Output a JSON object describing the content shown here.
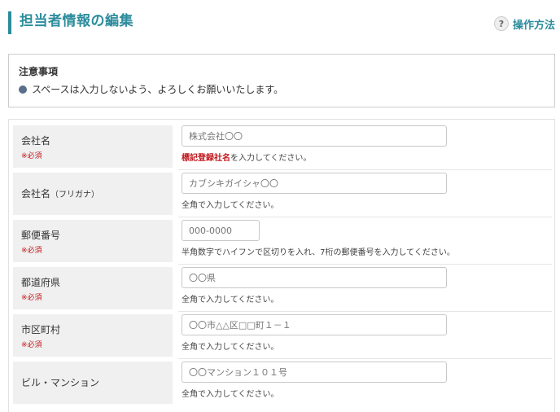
{
  "header": {
    "title": "担当者情報の編集",
    "help_icon": "question-circle-icon",
    "help_label": "操作方法"
  },
  "notice": {
    "title": "注意事項",
    "items": [
      "スペースは入力しないよう、よろしくお願いいたします。"
    ]
  },
  "form": {
    "company": {
      "label": "会社名",
      "required": "※必須",
      "placeholder": "株式会社〇〇",
      "help_emph": "標記登録社名",
      "help_rest": "を入力してください。"
    },
    "company_kana": {
      "label": "会社名",
      "label_suffix": "（フリガナ）",
      "placeholder": "カブシキガイシャ〇〇",
      "help": "全角で入力してください。"
    },
    "postal": {
      "label": "郵便番号",
      "required": "※必須",
      "placeholder": "000-0000",
      "help": "半角数字でハイフンで区切りを入れ、7桁の郵便番号を入力してください。"
    },
    "prefecture": {
      "label": "都道府県",
      "required": "※必須",
      "placeholder": "〇〇県",
      "help": "全角で入力してください。"
    },
    "city": {
      "label": "市区町村",
      "required": "※必須",
      "placeholder": "〇〇市△△区□□町１－１",
      "help": "全角で入力してください。"
    },
    "building": {
      "label": "ビル・マンション",
      "placeholder": "〇〇マンション１０１号",
      "help": "全角で入力してください。"
    }
  },
  "colors": {
    "accent": "#2c8c9c",
    "required": "#c0171c",
    "label_bg": "#f0f0f0"
  }
}
